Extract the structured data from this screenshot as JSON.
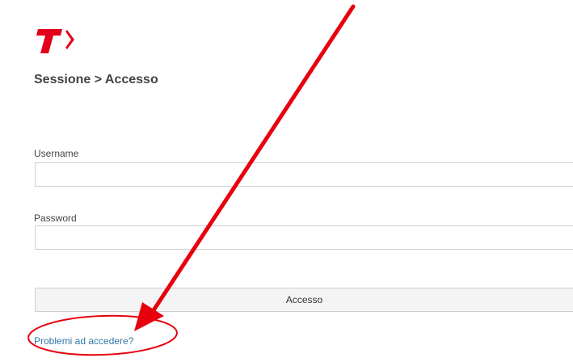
{
  "header": {
    "logo_icon": "brand-logo-icon",
    "brand_color": "#e3001b",
    "breadcrumb": "Sessione > Accesso"
  },
  "form": {
    "username_label": "Username",
    "username_value": "",
    "password_label": "Password",
    "password_value": "",
    "submit_label": "Accesso",
    "help_link": "Problemi ad accedere?"
  },
  "annotation": {
    "arrow_icon": "red-arrow-annotation",
    "ellipse_icon": "red-ellipse-annotation",
    "color": "#e8000d"
  }
}
